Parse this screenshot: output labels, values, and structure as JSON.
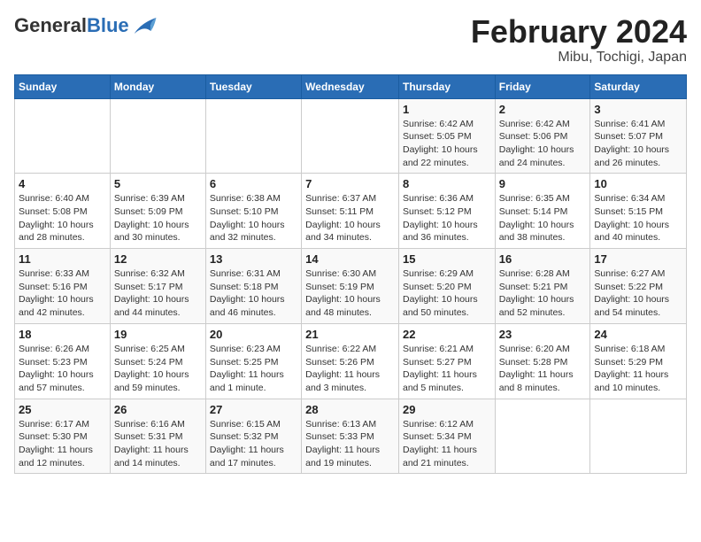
{
  "header": {
    "logo_general": "General",
    "logo_blue": "Blue",
    "month_title": "February 2024",
    "location": "Mibu, Tochigi, Japan"
  },
  "weekdays": [
    "Sunday",
    "Monday",
    "Tuesday",
    "Wednesday",
    "Thursday",
    "Friday",
    "Saturday"
  ],
  "weeks": [
    [
      {
        "num": "",
        "info": ""
      },
      {
        "num": "",
        "info": ""
      },
      {
        "num": "",
        "info": ""
      },
      {
        "num": "",
        "info": ""
      },
      {
        "num": "1",
        "info": "Sunrise: 6:42 AM\nSunset: 5:05 PM\nDaylight: 10 hours and 22 minutes."
      },
      {
        "num": "2",
        "info": "Sunrise: 6:42 AM\nSunset: 5:06 PM\nDaylight: 10 hours and 24 minutes."
      },
      {
        "num": "3",
        "info": "Sunrise: 6:41 AM\nSunset: 5:07 PM\nDaylight: 10 hours and 26 minutes."
      }
    ],
    [
      {
        "num": "4",
        "info": "Sunrise: 6:40 AM\nSunset: 5:08 PM\nDaylight: 10 hours and 28 minutes."
      },
      {
        "num": "5",
        "info": "Sunrise: 6:39 AM\nSunset: 5:09 PM\nDaylight: 10 hours and 30 minutes."
      },
      {
        "num": "6",
        "info": "Sunrise: 6:38 AM\nSunset: 5:10 PM\nDaylight: 10 hours and 32 minutes."
      },
      {
        "num": "7",
        "info": "Sunrise: 6:37 AM\nSunset: 5:11 PM\nDaylight: 10 hours and 34 minutes."
      },
      {
        "num": "8",
        "info": "Sunrise: 6:36 AM\nSunset: 5:12 PM\nDaylight: 10 hours and 36 minutes."
      },
      {
        "num": "9",
        "info": "Sunrise: 6:35 AM\nSunset: 5:14 PM\nDaylight: 10 hours and 38 minutes."
      },
      {
        "num": "10",
        "info": "Sunrise: 6:34 AM\nSunset: 5:15 PM\nDaylight: 10 hours and 40 minutes."
      }
    ],
    [
      {
        "num": "11",
        "info": "Sunrise: 6:33 AM\nSunset: 5:16 PM\nDaylight: 10 hours and 42 minutes."
      },
      {
        "num": "12",
        "info": "Sunrise: 6:32 AM\nSunset: 5:17 PM\nDaylight: 10 hours and 44 minutes."
      },
      {
        "num": "13",
        "info": "Sunrise: 6:31 AM\nSunset: 5:18 PM\nDaylight: 10 hours and 46 minutes."
      },
      {
        "num": "14",
        "info": "Sunrise: 6:30 AM\nSunset: 5:19 PM\nDaylight: 10 hours and 48 minutes."
      },
      {
        "num": "15",
        "info": "Sunrise: 6:29 AM\nSunset: 5:20 PM\nDaylight: 10 hours and 50 minutes."
      },
      {
        "num": "16",
        "info": "Sunrise: 6:28 AM\nSunset: 5:21 PM\nDaylight: 10 hours and 52 minutes."
      },
      {
        "num": "17",
        "info": "Sunrise: 6:27 AM\nSunset: 5:22 PM\nDaylight: 10 hours and 54 minutes."
      }
    ],
    [
      {
        "num": "18",
        "info": "Sunrise: 6:26 AM\nSunset: 5:23 PM\nDaylight: 10 hours and 57 minutes."
      },
      {
        "num": "19",
        "info": "Sunrise: 6:25 AM\nSunset: 5:24 PM\nDaylight: 10 hours and 59 minutes."
      },
      {
        "num": "20",
        "info": "Sunrise: 6:23 AM\nSunset: 5:25 PM\nDaylight: 11 hours and 1 minute."
      },
      {
        "num": "21",
        "info": "Sunrise: 6:22 AM\nSunset: 5:26 PM\nDaylight: 11 hours and 3 minutes."
      },
      {
        "num": "22",
        "info": "Sunrise: 6:21 AM\nSunset: 5:27 PM\nDaylight: 11 hours and 5 minutes."
      },
      {
        "num": "23",
        "info": "Sunrise: 6:20 AM\nSunset: 5:28 PM\nDaylight: 11 hours and 8 minutes."
      },
      {
        "num": "24",
        "info": "Sunrise: 6:18 AM\nSunset: 5:29 PM\nDaylight: 11 hours and 10 minutes."
      }
    ],
    [
      {
        "num": "25",
        "info": "Sunrise: 6:17 AM\nSunset: 5:30 PM\nDaylight: 11 hours and 12 minutes."
      },
      {
        "num": "26",
        "info": "Sunrise: 6:16 AM\nSunset: 5:31 PM\nDaylight: 11 hours and 14 minutes."
      },
      {
        "num": "27",
        "info": "Sunrise: 6:15 AM\nSunset: 5:32 PM\nDaylight: 11 hours and 17 minutes."
      },
      {
        "num": "28",
        "info": "Sunrise: 6:13 AM\nSunset: 5:33 PM\nDaylight: 11 hours and 19 minutes."
      },
      {
        "num": "29",
        "info": "Sunrise: 6:12 AM\nSunset: 5:34 PM\nDaylight: 11 hours and 21 minutes."
      },
      {
        "num": "",
        "info": ""
      },
      {
        "num": "",
        "info": ""
      }
    ]
  ]
}
